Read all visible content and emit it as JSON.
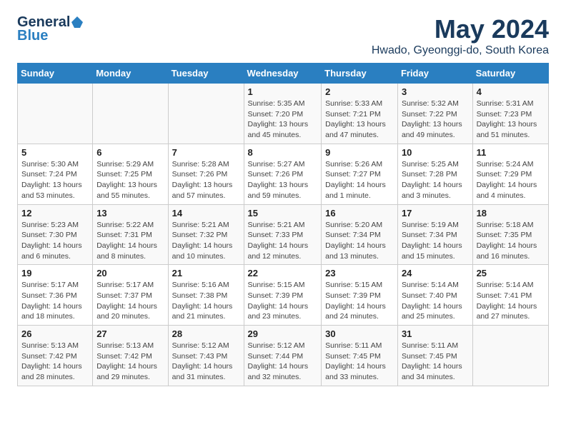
{
  "header": {
    "logo_general": "General",
    "logo_blue": "Blue",
    "month": "May 2024",
    "location": "Hwado, Gyeonggi-do, South Korea"
  },
  "days_of_week": [
    "Sunday",
    "Monday",
    "Tuesday",
    "Wednesday",
    "Thursday",
    "Friday",
    "Saturday"
  ],
  "weeks": [
    [
      {
        "day": "",
        "sunrise": "",
        "sunset": "",
        "daylight": ""
      },
      {
        "day": "",
        "sunrise": "",
        "sunset": "",
        "daylight": ""
      },
      {
        "day": "",
        "sunrise": "",
        "sunset": "",
        "daylight": ""
      },
      {
        "day": "1",
        "sunrise": "Sunrise: 5:35 AM",
        "sunset": "Sunset: 7:20 PM",
        "daylight": "Daylight: 13 hours and 45 minutes."
      },
      {
        "day": "2",
        "sunrise": "Sunrise: 5:33 AM",
        "sunset": "Sunset: 7:21 PM",
        "daylight": "Daylight: 13 hours and 47 minutes."
      },
      {
        "day": "3",
        "sunrise": "Sunrise: 5:32 AM",
        "sunset": "Sunset: 7:22 PM",
        "daylight": "Daylight: 13 hours and 49 minutes."
      },
      {
        "day": "4",
        "sunrise": "Sunrise: 5:31 AM",
        "sunset": "Sunset: 7:23 PM",
        "daylight": "Daylight: 13 hours and 51 minutes."
      }
    ],
    [
      {
        "day": "5",
        "sunrise": "Sunrise: 5:30 AM",
        "sunset": "Sunset: 7:24 PM",
        "daylight": "Daylight: 13 hours and 53 minutes."
      },
      {
        "day": "6",
        "sunrise": "Sunrise: 5:29 AM",
        "sunset": "Sunset: 7:25 PM",
        "daylight": "Daylight: 13 hours and 55 minutes."
      },
      {
        "day": "7",
        "sunrise": "Sunrise: 5:28 AM",
        "sunset": "Sunset: 7:26 PM",
        "daylight": "Daylight: 13 hours and 57 minutes."
      },
      {
        "day": "8",
        "sunrise": "Sunrise: 5:27 AM",
        "sunset": "Sunset: 7:26 PM",
        "daylight": "Daylight: 13 hours and 59 minutes."
      },
      {
        "day": "9",
        "sunrise": "Sunrise: 5:26 AM",
        "sunset": "Sunset: 7:27 PM",
        "daylight": "Daylight: 14 hours and 1 minute."
      },
      {
        "day": "10",
        "sunrise": "Sunrise: 5:25 AM",
        "sunset": "Sunset: 7:28 PM",
        "daylight": "Daylight: 14 hours and 3 minutes."
      },
      {
        "day": "11",
        "sunrise": "Sunrise: 5:24 AM",
        "sunset": "Sunset: 7:29 PM",
        "daylight": "Daylight: 14 hours and 4 minutes."
      }
    ],
    [
      {
        "day": "12",
        "sunrise": "Sunrise: 5:23 AM",
        "sunset": "Sunset: 7:30 PM",
        "daylight": "Daylight: 14 hours and 6 minutes."
      },
      {
        "day": "13",
        "sunrise": "Sunrise: 5:22 AM",
        "sunset": "Sunset: 7:31 PM",
        "daylight": "Daylight: 14 hours and 8 minutes."
      },
      {
        "day": "14",
        "sunrise": "Sunrise: 5:21 AM",
        "sunset": "Sunset: 7:32 PM",
        "daylight": "Daylight: 14 hours and 10 minutes."
      },
      {
        "day": "15",
        "sunrise": "Sunrise: 5:21 AM",
        "sunset": "Sunset: 7:33 PM",
        "daylight": "Daylight: 14 hours and 12 minutes."
      },
      {
        "day": "16",
        "sunrise": "Sunrise: 5:20 AM",
        "sunset": "Sunset: 7:34 PM",
        "daylight": "Daylight: 14 hours and 13 minutes."
      },
      {
        "day": "17",
        "sunrise": "Sunrise: 5:19 AM",
        "sunset": "Sunset: 7:34 PM",
        "daylight": "Daylight: 14 hours and 15 minutes."
      },
      {
        "day": "18",
        "sunrise": "Sunrise: 5:18 AM",
        "sunset": "Sunset: 7:35 PM",
        "daylight": "Daylight: 14 hours and 16 minutes."
      }
    ],
    [
      {
        "day": "19",
        "sunrise": "Sunrise: 5:17 AM",
        "sunset": "Sunset: 7:36 PM",
        "daylight": "Daylight: 14 hours and 18 minutes."
      },
      {
        "day": "20",
        "sunrise": "Sunrise: 5:17 AM",
        "sunset": "Sunset: 7:37 PM",
        "daylight": "Daylight: 14 hours and 20 minutes."
      },
      {
        "day": "21",
        "sunrise": "Sunrise: 5:16 AM",
        "sunset": "Sunset: 7:38 PM",
        "daylight": "Daylight: 14 hours and 21 minutes."
      },
      {
        "day": "22",
        "sunrise": "Sunrise: 5:15 AM",
        "sunset": "Sunset: 7:39 PM",
        "daylight": "Daylight: 14 hours and 23 minutes."
      },
      {
        "day": "23",
        "sunrise": "Sunrise: 5:15 AM",
        "sunset": "Sunset: 7:39 PM",
        "daylight": "Daylight: 14 hours and 24 minutes."
      },
      {
        "day": "24",
        "sunrise": "Sunrise: 5:14 AM",
        "sunset": "Sunset: 7:40 PM",
        "daylight": "Daylight: 14 hours and 25 minutes."
      },
      {
        "day": "25",
        "sunrise": "Sunrise: 5:14 AM",
        "sunset": "Sunset: 7:41 PM",
        "daylight": "Daylight: 14 hours and 27 minutes."
      }
    ],
    [
      {
        "day": "26",
        "sunrise": "Sunrise: 5:13 AM",
        "sunset": "Sunset: 7:42 PM",
        "daylight": "Daylight: 14 hours and 28 minutes."
      },
      {
        "day": "27",
        "sunrise": "Sunrise: 5:13 AM",
        "sunset": "Sunset: 7:42 PM",
        "daylight": "Daylight: 14 hours and 29 minutes."
      },
      {
        "day": "28",
        "sunrise": "Sunrise: 5:12 AM",
        "sunset": "Sunset: 7:43 PM",
        "daylight": "Daylight: 14 hours and 31 minutes."
      },
      {
        "day": "29",
        "sunrise": "Sunrise: 5:12 AM",
        "sunset": "Sunset: 7:44 PM",
        "daylight": "Daylight: 14 hours and 32 minutes."
      },
      {
        "day": "30",
        "sunrise": "Sunrise: 5:11 AM",
        "sunset": "Sunset: 7:45 PM",
        "daylight": "Daylight: 14 hours and 33 minutes."
      },
      {
        "day": "31",
        "sunrise": "Sunrise: 5:11 AM",
        "sunset": "Sunset: 7:45 PM",
        "daylight": "Daylight: 14 hours and 34 minutes."
      },
      {
        "day": "",
        "sunrise": "",
        "sunset": "",
        "daylight": ""
      }
    ]
  ]
}
